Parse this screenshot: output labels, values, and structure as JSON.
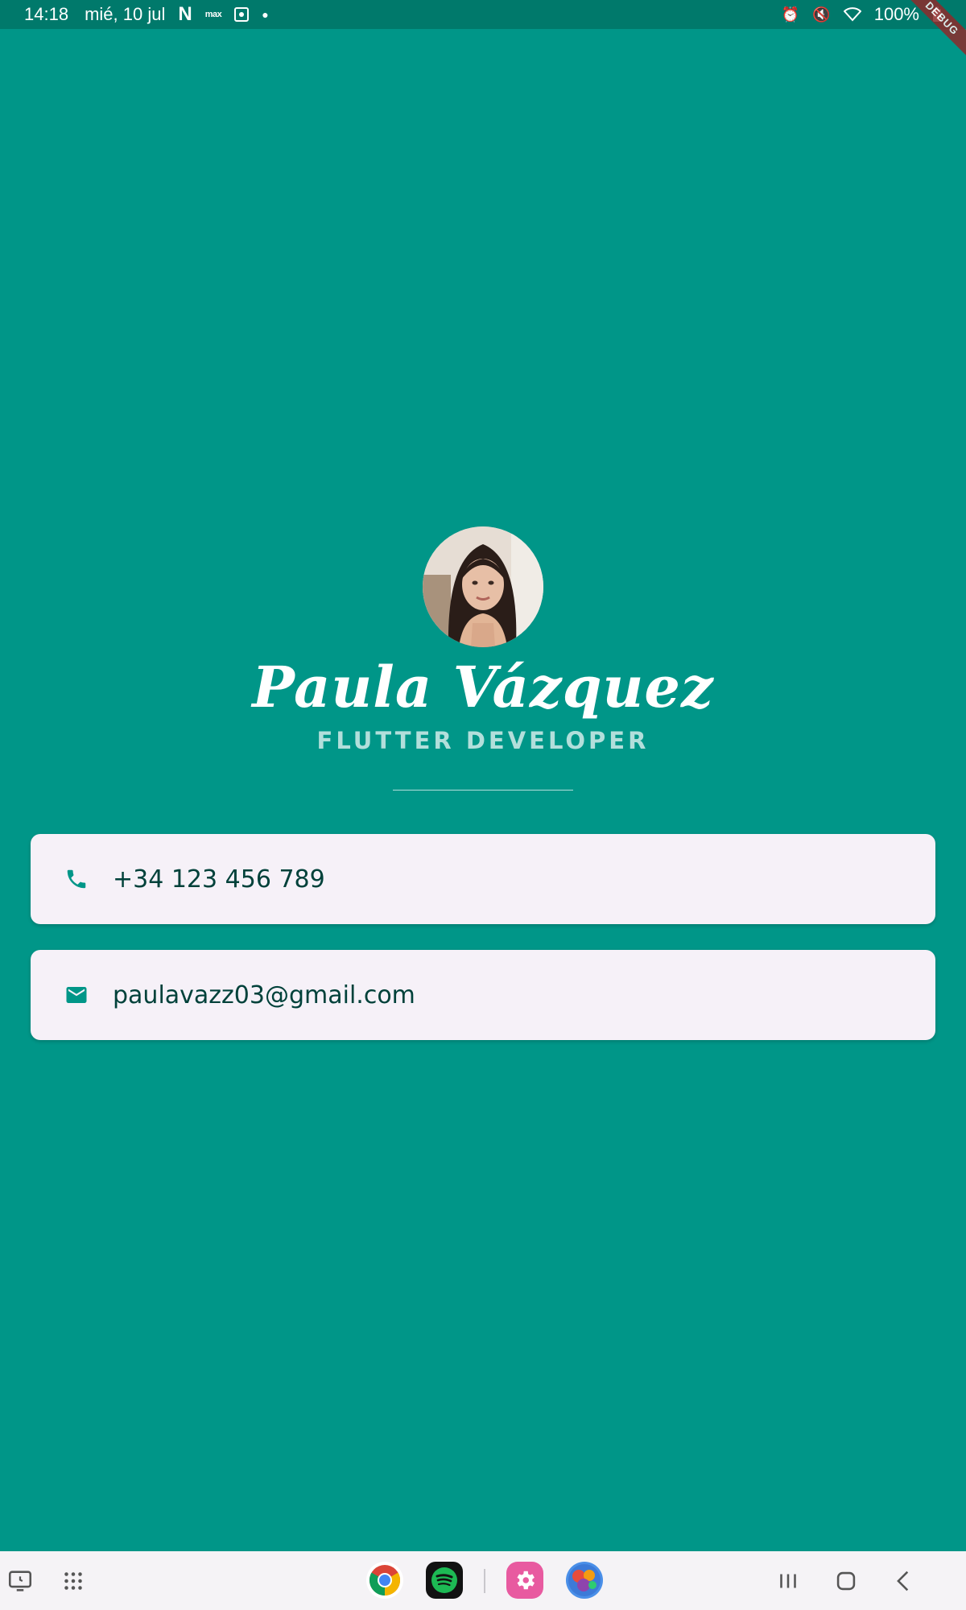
{
  "status_bar": {
    "time": "14:18",
    "date": "mié, 10 jul",
    "left_icons": [
      "netflix-icon",
      "max-icon",
      "screenshot-icon",
      "dot-icon"
    ],
    "battery": "100%",
    "right_icons": [
      "alarm-icon",
      "mute-icon",
      "wifi-icon",
      "battery-icon"
    ]
  },
  "debug_banner": "DEBUG",
  "profile": {
    "name": "Paula Vázquez",
    "role": "FLUTTER DEVELOPER"
  },
  "contacts": [
    {
      "icon": "phone-icon",
      "value": "+34 123 456 789"
    },
    {
      "icon": "email-icon",
      "value": "paulavazz03@gmail.com"
    }
  ],
  "navbar": {
    "left": [
      "recent-screens-icon",
      "app-drawer-icon"
    ],
    "apps": [
      "chrome-app-icon",
      "spotify-app-icon",
      "settings-app-icon",
      "candy-crush-app-icon"
    ],
    "right": [
      "recents-button",
      "home-button",
      "back-button"
    ]
  },
  "colors": {
    "background": "#009688",
    "status_bar": "#00796b",
    "card": "#f6f1f8",
    "card_text": "#00413a",
    "accent_icon": "#009688",
    "role_text": "#b2dfdb"
  }
}
